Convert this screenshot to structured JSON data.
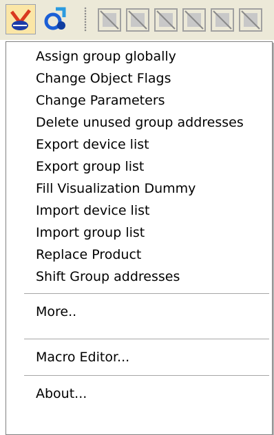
{
  "colors": {
    "menu_bg": "#ffffff",
    "toolbar_bg": "#ece9d8",
    "active_button_bg": "#fbe6a6",
    "separator": "#a5a5a5"
  },
  "toolbar": {
    "icons": [
      "macro-tool-icon",
      "refresh-tool-icon",
      "grid-tool-icon",
      "grid-tool-icon",
      "grid-tool-icon",
      "grid-tool-icon",
      "grid-tool-icon",
      "grid-tool-icon"
    ]
  },
  "menu": {
    "group1": [
      {
        "label": "Assign group globally"
      },
      {
        "label": "Change Object Flags"
      },
      {
        "label": "Change Parameters"
      },
      {
        "label": "Delete unused group addresses"
      },
      {
        "label": "Export device list"
      },
      {
        "label": "Export group list"
      },
      {
        "label": "Fill Visualization Dummy"
      },
      {
        "label": "Import device list"
      },
      {
        "label": "Import group list"
      },
      {
        "label": "Replace Product"
      },
      {
        "label": "Shift Group addresses"
      }
    ],
    "more": "More..",
    "macro_editor": "Macro Editor...",
    "about": "About..."
  }
}
